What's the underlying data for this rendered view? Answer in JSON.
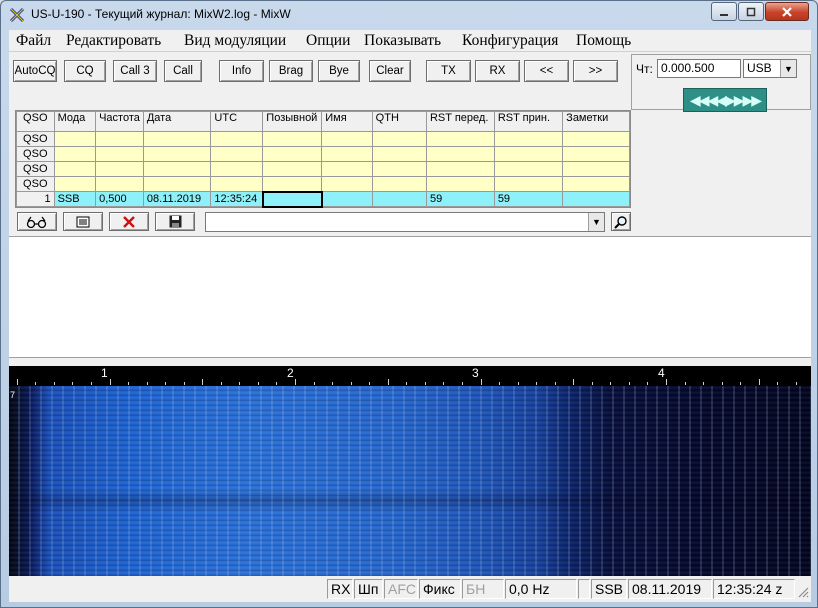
{
  "window": {
    "title": "US-U-190 - Текущий журнал: MixW2.log - MixW"
  },
  "menu": [
    "Файл",
    "Редактировать",
    "Вид модуляции",
    "Опции",
    "Показывать",
    "Конфигурация",
    "Помощь"
  ],
  "toolbar": {
    "autocq": "AutoCQ",
    "cq": "CQ",
    "call3": "Call 3",
    "call": "Call",
    "info": "Info",
    "brag": "Brag",
    "bye": "Bye",
    "clear": "Clear",
    "tx": "TX",
    "rx": "RX",
    "prev": "<<",
    "next": ">>"
  },
  "rig": {
    "freq_label": "Чт:",
    "freq_value": "0.000.500",
    "mode_value": "USB",
    "tuner_glyph": "◀◀◀◀▶▶▶▶"
  },
  "log": {
    "headers": [
      "QSO",
      "Мода",
      "Частота",
      "Дата",
      "UTC",
      "Позывной",
      "Имя",
      "QTH",
      "RST перед.",
      "RST прин.",
      "Заметки"
    ],
    "empty_rows": [
      "QSO",
      "QSO",
      "QSO",
      "QSO"
    ],
    "current": {
      "num": "1",
      "mode": "SSB",
      "freq": "0,500",
      "date": "08.11.2019",
      "utc": "12:35:24",
      "call": "",
      "name": "",
      "qth": "",
      "rst_sent": "59",
      "rst_rcvd": "59",
      "notes": ""
    }
  },
  "waterfall": {
    "ticks": [
      "1",
      "2",
      "3",
      "4"
    ],
    "side_mark": "7"
  },
  "status": {
    "rx": "RX",
    "shp": "Шп",
    "afc": "AFC",
    "fix": "Фикс",
    "bn": "БН",
    "offset": "0,0 Hz",
    "blank": "",
    "mode": "SSB",
    "date": "08.11.2019",
    "time": "12:35:24 z"
  }
}
